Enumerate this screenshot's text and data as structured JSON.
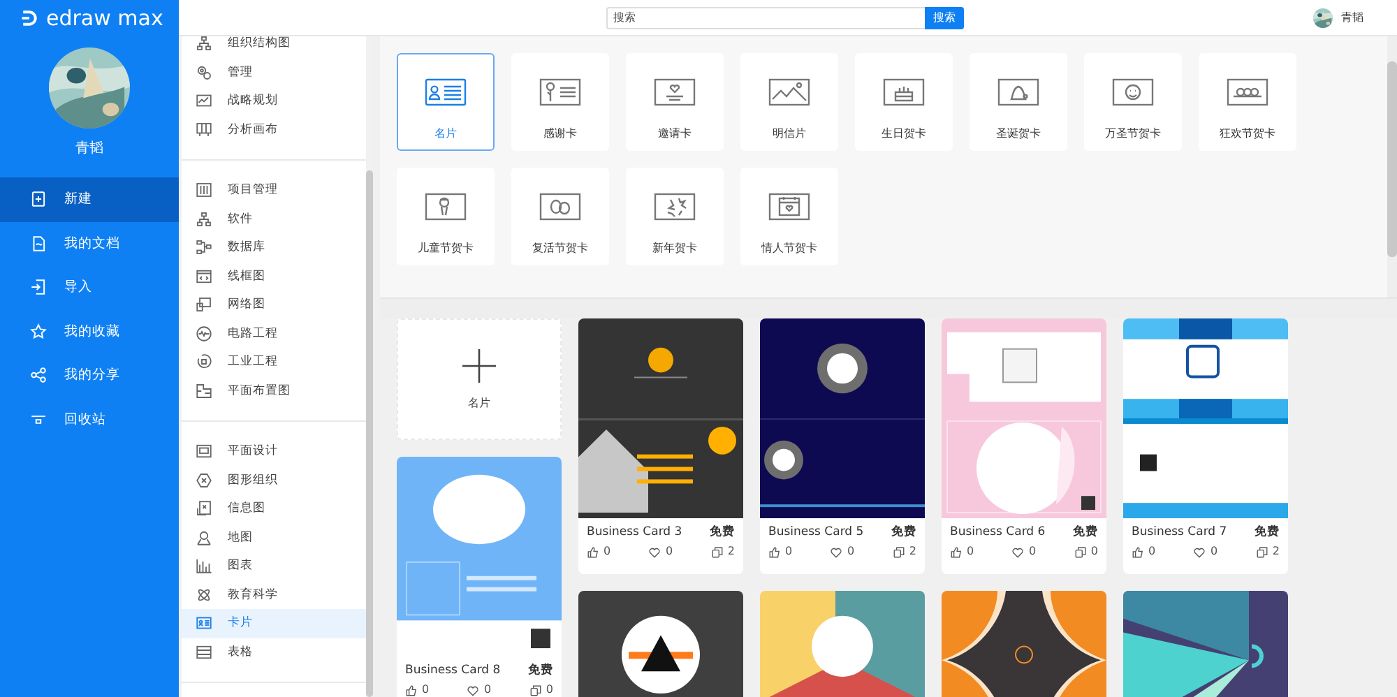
{
  "app": {
    "logo": "edraw max"
  },
  "user": {
    "name": "青韬"
  },
  "nav": [
    {
      "label": "新建",
      "selected": true
    },
    {
      "label": "我的文档",
      "selected": false
    },
    {
      "label": "导入",
      "selected": false
    },
    {
      "label": "我的收藏",
      "selected": false
    },
    {
      "label": "我的分享",
      "selected": false
    },
    {
      "label": "回收站",
      "selected": false
    }
  ],
  "search": {
    "placeholder": "搜索",
    "button": "搜索"
  },
  "top_user": {
    "name": "青韬"
  },
  "categories": [
    {
      "items": [
        {
          "label": "组织结构图",
          "selected": false
        },
        {
          "label": "管理",
          "selected": false
        },
        {
          "label": "战略规划",
          "selected": false
        },
        {
          "label": "分析画布",
          "selected": false
        }
      ]
    },
    {
      "items": [
        {
          "label": "项目管理",
          "selected": false
        },
        {
          "label": "软件",
          "selected": false
        },
        {
          "label": "数据库",
          "selected": false
        },
        {
          "label": "线框图",
          "selected": false
        },
        {
          "label": "网络图",
          "selected": false
        },
        {
          "label": "电路工程",
          "selected": false
        },
        {
          "label": "工业工程",
          "selected": false
        },
        {
          "label": "平面布置图",
          "selected": false
        }
      ]
    },
    {
      "items": [
        {
          "label": "平面设计",
          "selected": false
        },
        {
          "label": "图形组织",
          "selected": false
        },
        {
          "label": "信息图",
          "selected": false
        },
        {
          "label": "地图",
          "selected": false
        },
        {
          "label": "图表",
          "selected": false
        },
        {
          "label": "教育科学",
          "selected": false
        },
        {
          "label": "卡片",
          "selected": true
        },
        {
          "label": "表格",
          "selected": false
        }
      ]
    }
  ],
  "templates": [
    {
      "label": "名片",
      "selected": true
    },
    {
      "label": "感谢卡",
      "selected": false
    },
    {
      "label": "邀请卡",
      "selected": false
    },
    {
      "label": "明信片",
      "selected": false
    },
    {
      "label": "生日贺卡",
      "selected": false
    },
    {
      "label": "圣诞贺卡",
      "selected": false
    },
    {
      "label": "万圣节贺卡",
      "selected": false
    },
    {
      "label": "狂欢节贺卡",
      "selected": false
    },
    {
      "label": "儿童节贺卡",
      "selected": false
    },
    {
      "label": "复活节贺卡",
      "selected": false
    },
    {
      "label": "新年贺卡",
      "selected": false
    },
    {
      "label": "情人节贺卡",
      "selected": false
    }
  ],
  "card_columns": [
    [
      {
        "kind": "new",
        "label": "名片"
      },
      {
        "kind": "card",
        "title": "Business Card 8",
        "price": "免费",
        "likes": "0",
        "favorites": "0",
        "copies": "0"
      }
    ],
    [
      {
        "kind": "card",
        "title": "Business Card 3",
        "price": "免费",
        "likes": "0",
        "favorites": "0",
        "copies": "2"
      },
      {
        "kind": "picture"
      }
    ],
    [
      {
        "kind": "card",
        "title": "Business Card 5",
        "price": "免费",
        "likes": "0",
        "favorites": "0",
        "copies": "2"
      },
      {
        "kind": "picture"
      }
    ],
    [
      {
        "kind": "card",
        "title": "Business Card 6",
        "price": "免费",
        "likes": "0",
        "favorites": "0",
        "copies": "0"
      },
      {
        "kind": "picture"
      }
    ],
    [
      {
        "kind": "card",
        "title": "Business Card 7",
        "price": "免费",
        "likes": "0",
        "favorites": "0",
        "copies": "2"
      },
      {
        "kind": "picture"
      }
    ]
  ]
}
